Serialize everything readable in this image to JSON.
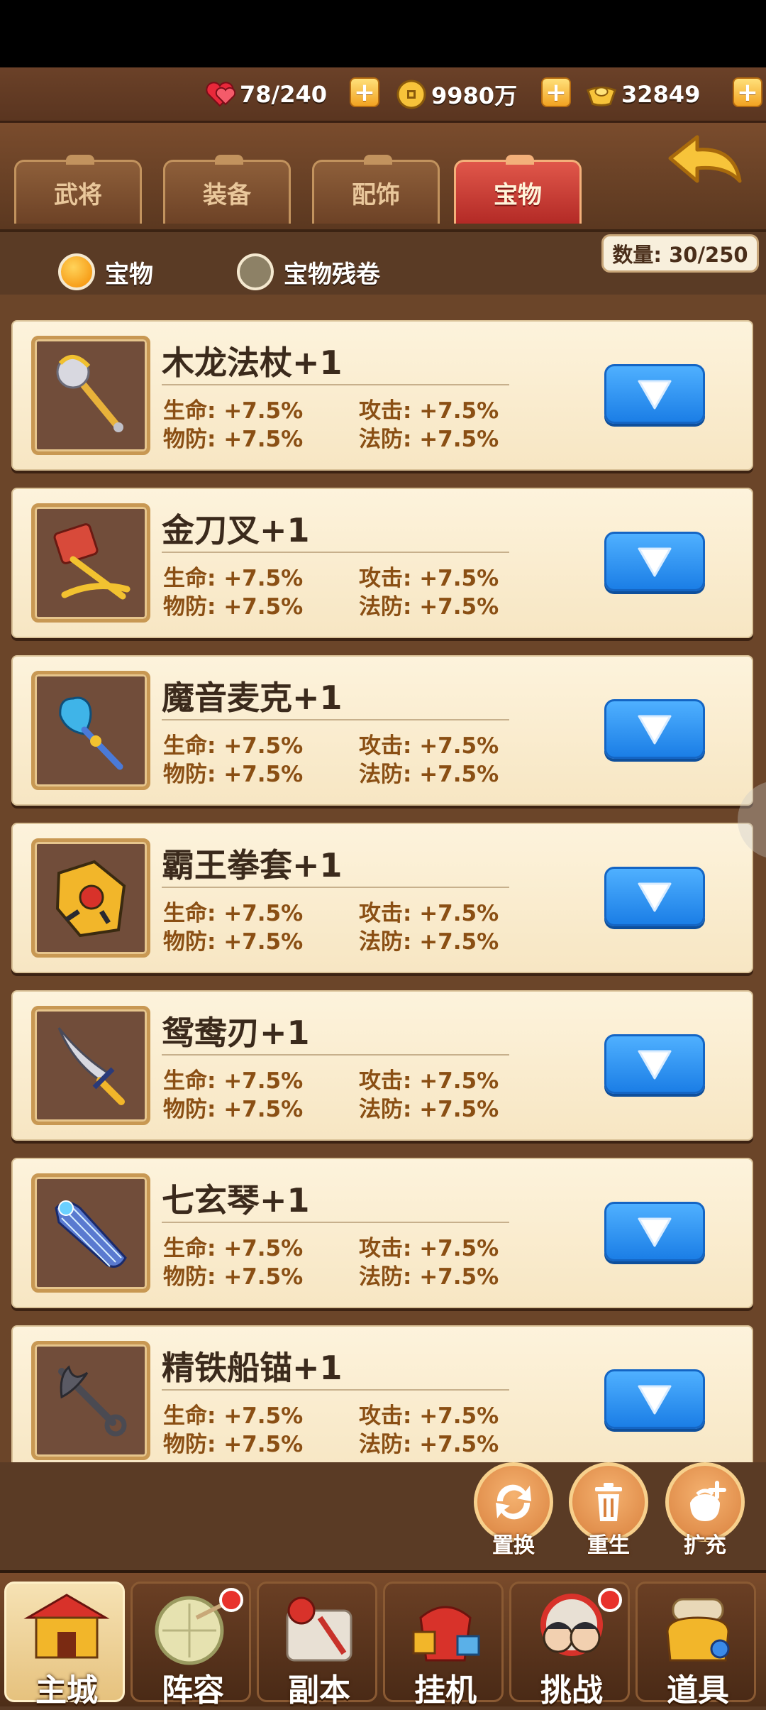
{
  "resources": {
    "stamina": "78/240",
    "gold": "9980万",
    "ingot": "32849",
    "plus": "+"
  },
  "tabs": [
    {
      "label": "武将",
      "active": false
    },
    {
      "label": "装备",
      "active": false
    },
    {
      "label": "配饰",
      "active": false
    },
    {
      "label": "宝物",
      "active": true
    }
  ],
  "filters": [
    {
      "label": "宝物",
      "selected": true
    },
    {
      "label": "宝物残卷",
      "selected": false
    }
  ],
  "count": "数量: 30/250",
  "items": [
    {
      "name": "木龙法杖+1",
      "icon": "wooden-dragon-staff-icon",
      "stats": [
        "生命: +7.5%",
        "攻击: +7.5%",
        "物防: +7.5%",
        "法防: +7.5%"
      ]
    },
    {
      "name": "金刀叉+1",
      "icon": "golden-fork-knife-icon",
      "stats": [
        "生命: +7.5%",
        "攻击: +7.5%",
        "物防: +7.5%",
        "法防: +7.5%"
      ]
    },
    {
      "name": "魔音麦克+1",
      "icon": "magic-microphone-icon",
      "stats": [
        "生命: +7.5%",
        "攻击: +7.5%",
        "物防: +7.5%",
        "法防: +7.5%"
      ]
    },
    {
      "name": "霸王拳套+1",
      "icon": "overlord-gauntlet-icon",
      "stats": [
        "生命: +7.5%",
        "攻击: +7.5%",
        "物防: +7.5%",
        "法防: +7.5%"
      ]
    },
    {
      "name": "鸳鸯刃+1",
      "icon": "curved-blade-icon",
      "stats": [
        "生命: +7.5%",
        "攻击: +7.5%",
        "物防: +7.5%",
        "法防: +7.5%"
      ]
    },
    {
      "name": "七玄琴+1",
      "icon": "seven-string-zither-icon",
      "stats": [
        "生命: +7.5%",
        "攻击: +7.5%",
        "物防: +7.5%",
        "法防: +7.5%"
      ]
    },
    {
      "name": "精铁船锚+1",
      "icon": "iron-anchor-icon",
      "stats": [
        "生命: +7.5%",
        "攻击: +7.5%",
        "物防: +7.5%",
        "法防: +7.5%"
      ]
    }
  ],
  "actions": [
    {
      "label": "置换",
      "icon": "swap-arrows-icon"
    },
    {
      "label": "重生",
      "icon": "trash-bin-icon"
    },
    {
      "label": "扩充",
      "icon": "expand-bag-icon"
    }
  ],
  "nav": [
    {
      "label": "主城",
      "icon": "main-city-icon",
      "active": true,
      "dot": false
    },
    {
      "label": "阵容",
      "icon": "lineup-icon",
      "active": false,
      "dot": true
    },
    {
      "label": "副本",
      "icon": "dungeon-icon",
      "active": false,
      "dot": false
    },
    {
      "label": "挂机",
      "icon": "idle-icon",
      "active": false,
      "dot": false
    },
    {
      "label": "挑战",
      "icon": "challenge-icon",
      "active": false,
      "dot": true
    },
    {
      "label": "道具",
      "icon": "items-icon",
      "active": false,
      "dot": false
    }
  ],
  "colors": {
    "accent_blue": "#1b7ee6",
    "tab_active": "#b32a26",
    "stat_text": "#8a4f14",
    "card_bg": "#fdf3dc"
  }
}
